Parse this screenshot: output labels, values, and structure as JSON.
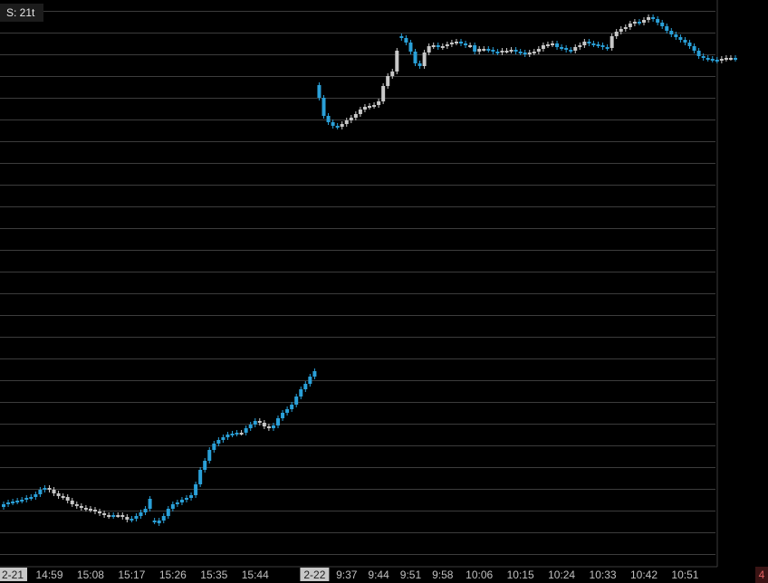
{
  "chart_header": {
    "symbol_label": "S: 21t"
  },
  "corner_badge": "4",
  "chart_data": {
    "type": "candlestick",
    "title": "",
    "xlabel": "",
    "ylabel": "",
    "y_axis_labels_visible": false,
    "grid": {
      "horizontal": true,
      "vertical": false
    },
    "colors": {
      "up": "#c8c8c8",
      "down": "#2aa0d8",
      "background": "#000000",
      "grid": "#3c3c3c",
      "axis_label": "#c0c0c0",
      "date_label_bg": "#c8c8c8"
    },
    "x_tick_labels": [
      {
        "label": "2-21",
        "date_marker": true,
        "index": 0
      },
      {
        "label": "14:59",
        "index": 10
      },
      {
        "label": "15:08",
        "index": 19
      },
      {
        "label": "15:17",
        "index": 28
      },
      {
        "label": "15:26",
        "index": 37
      },
      {
        "label": "15:35",
        "index": 46
      },
      {
        "label": "15:44",
        "index": 55
      },
      {
        "label": "2-22",
        "date_marker": true,
        "index": 68
      },
      {
        "label": "9:37",
        "index": 75
      },
      {
        "label": "9:44",
        "index": 82
      },
      {
        "label": "9:51",
        "index": 89
      },
      {
        "label": "9:58",
        "index": 96
      },
      {
        "label": "10:06",
        "index": 104
      },
      {
        "label": "10:15",
        "index": 113
      },
      {
        "label": "10:24",
        "index": 122
      },
      {
        "label": "10:33",
        "index": 131
      },
      {
        "label": "10:42",
        "index": 140
      },
      {
        "label": "10:51",
        "index": 149
      }
    ],
    "close": [
      560,
      557,
      555,
      554,
      553,
      552,
      550,
      549,
      546,
      541,
      539,
      541,
      545,
      548,
      549,
      553,
      557,
      559,
      561,
      562,
      563,
      565,
      567,
      569,
      570,
      569,
      569,
      571,
      574,
      573,
      570,
      566,
      562,
      576,
      578,
      575,
      570,
      562,
      557,
      555,
      552,
      550,
      547,
      535,
      519,
      509,
      497,
      490,
      486,
      483,
      480,
      479,
      478,
      478,
      473,
      469,
      465,
      467,
      471,
      473,
      470,
      462,
      456,
      452,
      447,
      438,
      430,
      424,
      416,
      108,
      128,
      135,
      139,
      140,
      137,
      133,
      130,
      126,
      121,
      118,
      117,
      116,
      112,
      95,
      84,
      79,
      56,
      42,
      47,
      57,
      70,
      73,
      58,
      51,
      50,
      52,
      51,
      49,
      47,
      46,
      48,
      50,
      50,
      57,
      54,
      54,
      55,
      57,
      58,
      56,
      56,
      55,
      57,
      58,
      60,
      58,
      57,
      54,
      50,
      49,
      48,
      52,
      53,
      55,
      56,
      52,
      50,
      46,
      48,
      49,
      50,
      52,
      53,
      40,
      35,
      32,
      30,
      26,
      24,
      25,
      22,
      19,
      21,
      25,
      29,
      34,
      38,
      41,
      44,
      47,
      51,
      56,
      62,
      64,
      65,
      66,
      67,
      65,
      64,
      64,
      65
    ],
    "open": [
      557,
      555,
      554,
      553,
      552,
      550,
      549,
      546,
      541,
      539,
      541,
      545,
      548,
      549,
      553,
      557,
      559,
      561,
      562,
      563,
      565,
      567,
      569,
      570,
      569,
      569,
      571,
      574,
      573,
      570,
      566,
      562,
      551,
      575,
      575,
      570,
      562,
      557,
      555,
      552,
      550,
      547,
      535,
      519,
      509,
      497,
      490,
      486,
      483,
      480,
      479,
      478,
      478,
      473,
      469,
      465,
      467,
      471,
      473,
      470,
      462,
      456,
      452,
      447,
      438,
      430,
      424,
      416,
      410,
      94,
      108,
      128,
      135,
      139,
      140,
      137,
      133,
      130,
      126,
      121,
      118,
      117,
      116,
      112,
      95,
      84,
      79,
      40,
      42,
      47,
      57,
      70,
      73,
      58,
      51,
      50,
      52,
      51,
      49,
      47,
      46,
      48,
      50,
      50,
      57,
      54,
      54,
      55,
      57,
      58,
      56,
      56,
      55,
      57,
      58,
      60,
      58,
      57,
      54,
      50,
      49,
      48,
      52,
      53,
      55,
      56,
      52,
      50,
      46,
      48,
      49,
      50,
      52,
      53,
      40,
      35,
      32,
      30,
      26,
      24,
      25,
      22,
      19,
      21,
      25,
      29,
      34,
      38,
      41,
      44,
      47,
      51,
      56,
      62,
      64,
      65,
      66,
      67,
      65,
      64,
      64
    ]
  }
}
